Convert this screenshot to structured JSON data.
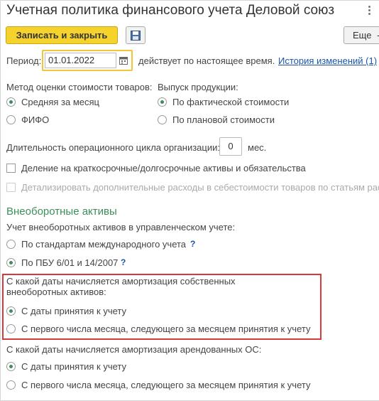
{
  "window": {
    "title": "Учетная политика финансового учета Деловой союз"
  },
  "toolbar": {
    "save_close_label": "Записать и закрыть",
    "more_label": "Еще",
    "more_arrow": "-"
  },
  "period": {
    "label": "Период:",
    "value": "01.01.2022",
    "suffix_text": "действует по настоящее время.",
    "history_link": "История изменений (1)"
  },
  "valuation": {
    "label": "Метод оценки стоимости товаров:",
    "options": [
      {
        "label": "Средняя за месяц",
        "selected": true
      },
      {
        "label": "ФИФО",
        "selected": false
      }
    ]
  },
  "production": {
    "label": "Выпуск продукции:",
    "options": [
      {
        "label": "По фактической стоимости",
        "selected": true
      },
      {
        "label": "По плановой стоимости",
        "selected": false
      }
    ]
  },
  "cycle": {
    "label": "Длительность операционного цикла организации:",
    "value": "0",
    "unit": "мес."
  },
  "checkboxes": {
    "split_assets": {
      "label": "Деление на краткосрочные/долгосрочные активы и обязательства",
      "checked": false
    },
    "detail_costs": {
      "label": "Детализировать дополнительные расходы в себестоимости товаров по статьям рас",
      "checked": false,
      "disabled": true
    }
  },
  "noncurrent": {
    "section_title": "Внеоборотные активы",
    "accounting_label": "Учет внеоборотных активов в управленческом учете:",
    "accounting_options": [
      {
        "label": "По стандартам международного учета",
        "selected": false,
        "help": "?"
      },
      {
        "label": "По ПБУ 6/01 и 14/2007",
        "selected": true,
        "help": "?"
      }
    ],
    "own_depr_label_1": "С какой даты начисляется амортизация собственных",
    "own_depr_label_2": "внеоборотных активов:",
    "own_depr_options": [
      {
        "label": "С даты принятия к учету",
        "selected": true
      },
      {
        "label": "С первого числа месяца, следующего за месяцем принятия к учету",
        "selected": false
      }
    ],
    "lease_depr_label": "С какой даты начисляется амортизация арендованных ОС:",
    "lease_depr_options": [
      {
        "label": "С даты принятия к учету",
        "selected": true
      },
      {
        "label": "С первого числа месяца, следующего за месяцем принятия к учету",
        "selected": false
      }
    ]
  },
  "colors": {
    "primary_button": "#f6d22d",
    "accent_green": "#3c8f5a",
    "link_blue": "#1a55a6",
    "highlight_red": "#d63a3a"
  }
}
